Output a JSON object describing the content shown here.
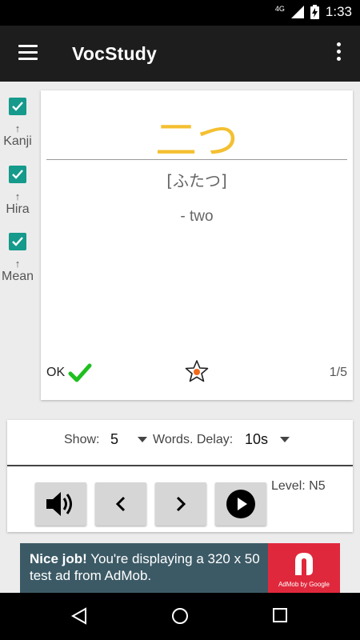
{
  "status": {
    "network": "4G",
    "time": "1:33"
  },
  "appbar": {
    "title": "VocStudy"
  },
  "side_toggles": [
    {
      "label": "Kanji",
      "checked": true,
      "arrow": "↑"
    },
    {
      "label": "Hira",
      "checked": true,
      "arrow": "↑"
    },
    {
      "label": "Mean",
      "checked": true,
      "arrow": "↑"
    }
  ],
  "card": {
    "kanji": "二つ",
    "reading": "[ふたつ]",
    "meaning": "- two",
    "ok_label": "OK",
    "counter": "1/5",
    "kanji_color": "#f4c031",
    "ok_color": "#1fbf1f"
  },
  "controls": {
    "show_label": "Show:",
    "show_value": "5",
    "delay_label": "Words. Delay:",
    "delay_value": "10s",
    "level": "Level: N5",
    "buttons": [
      "speaker-icon",
      "prev-icon",
      "next-icon",
      "play-icon"
    ]
  },
  "ad": {
    "headline": "Nice job!",
    "body": "You're displaying a 320 x 50 test ad from AdMob.",
    "logo_caption": "AdMob by Google"
  },
  "accent": "#159a8c"
}
